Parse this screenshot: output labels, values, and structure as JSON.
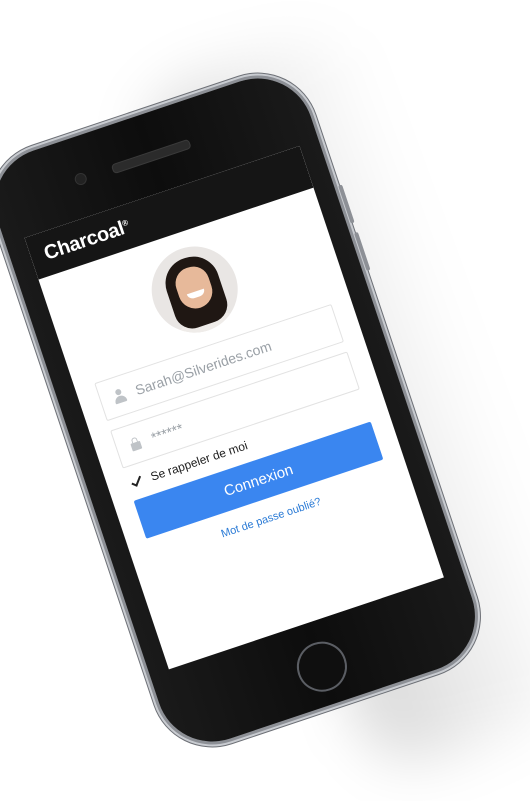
{
  "app": {
    "logo_text": "Charcoal",
    "logo_mark": "®"
  },
  "login": {
    "email_value": "Sarah@Silverides.com",
    "password_value": "******",
    "remember_label": "Se rappeler de moi",
    "submit_label": "Connexion",
    "forgot_label": "Mot de passe oublié?"
  },
  "icons": {
    "email": "user-icon",
    "password": "lock-icon",
    "remember": "checkmark-icon"
  },
  "colors": {
    "primary": "#3a86f0",
    "link": "#2b7bd6",
    "header": "#151515"
  }
}
